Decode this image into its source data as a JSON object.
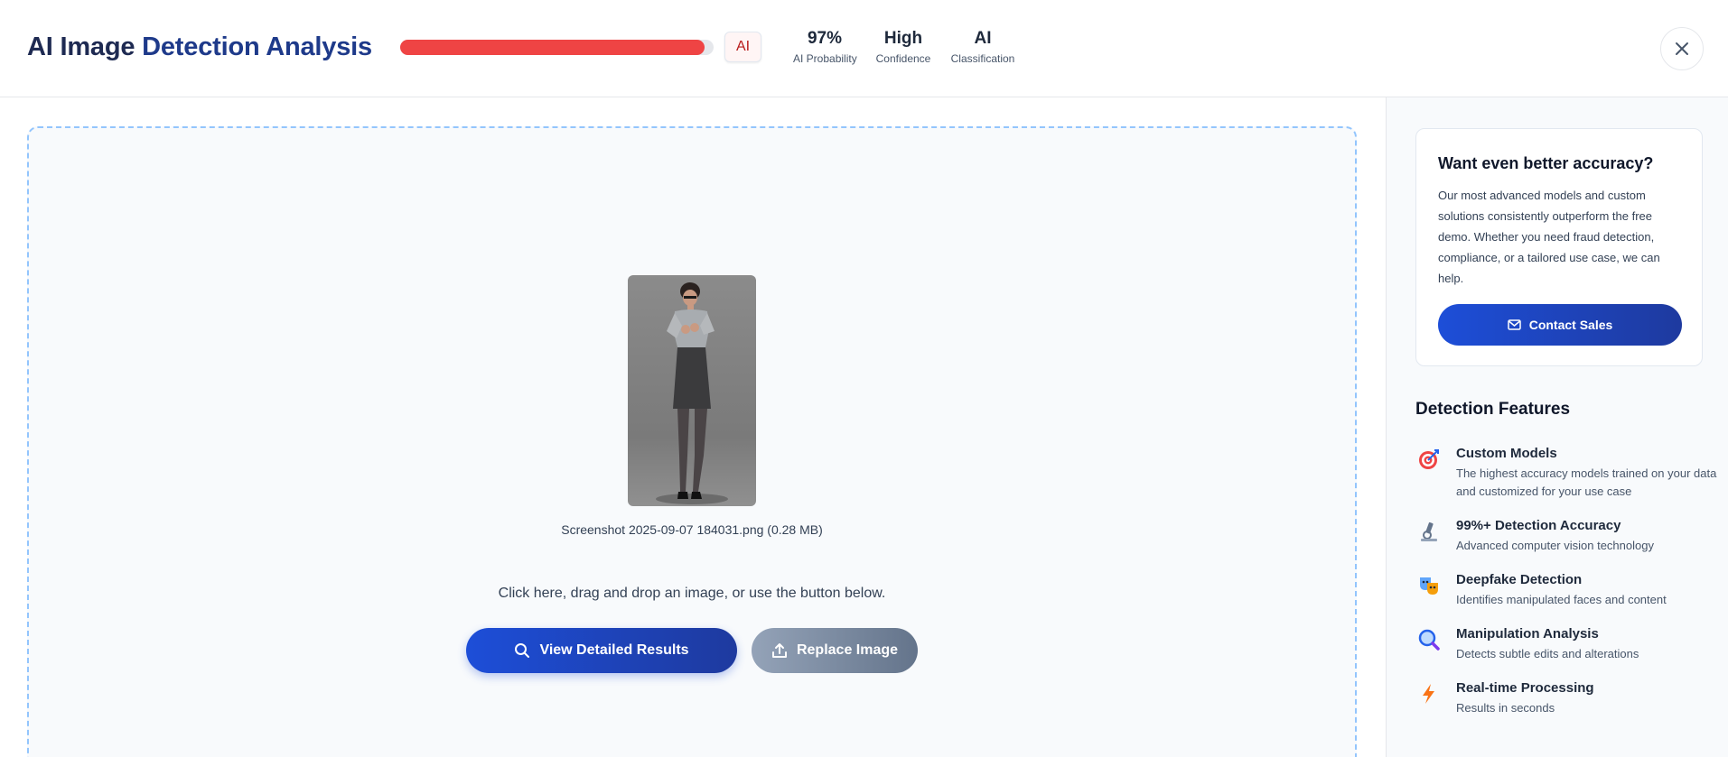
{
  "header": {
    "title_part1": "AI Image",
    "title_part2": "Detection Analysis",
    "progress_percent": 97,
    "badge": "AI",
    "stats": [
      {
        "value": "97%",
        "label": "AI Probability"
      },
      {
        "value": "High",
        "label": "Confidence"
      },
      {
        "value": "AI",
        "label": "Classification"
      }
    ],
    "close_icon": "close-icon",
    "colors": {
      "progress": "#ef4444",
      "accent": "#1d4ed8"
    }
  },
  "main": {
    "file_caption": "Screenshot 2025-09-07 184031.png (0.28 MB)",
    "hint": "Click here, drag and drop an image, or use the button below.",
    "view_results_label": "View Detailed Results",
    "replace_image_label": "Replace Image"
  },
  "sidebar": {
    "promo": {
      "title": "Want even better accuracy?",
      "text": "Our most advanced models and custom solutions consistently outperform the free demo. Whether you need fraud detection, compliance, or a tailored use case, we can help.",
      "button_label": "Contact Sales"
    },
    "features_title": "Detection Features",
    "features": [
      {
        "name": "Custom Models",
        "desc": "The highest accuracy models trained on your data and customized for your use case",
        "icon": "target-icon"
      },
      {
        "name": "99%+ Detection Accuracy",
        "desc": "Advanced computer vision technology",
        "icon": "microscope-icon"
      },
      {
        "name": "Deepfake Detection",
        "desc": "Identifies manipulated faces and content",
        "icon": "masks-icon"
      },
      {
        "name": "Manipulation Analysis",
        "desc": "Detects subtle edits and alterations",
        "icon": "magnifier-icon"
      },
      {
        "name": "Real-time Processing",
        "desc": "Results in seconds",
        "icon": "lightning-icon"
      }
    ]
  }
}
